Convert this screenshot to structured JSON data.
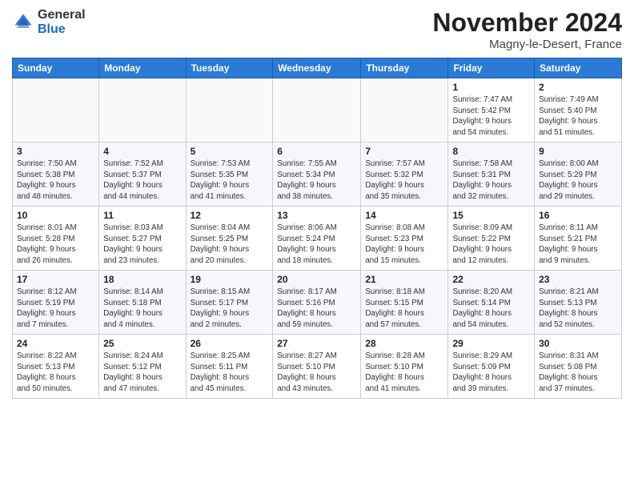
{
  "header": {
    "logo": {
      "general": "General",
      "blue": "Blue"
    },
    "title": "November 2024",
    "location": "Magny-le-Desert, France"
  },
  "weekdays": [
    "Sunday",
    "Monday",
    "Tuesday",
    "Wednesday",
    "Thursday",
    "Friday",
    "Saturday"
  ],
  "weeks": [
    [
      {
        "day": "",
        "info": ""
      },
      {
        "day": "",
        "info": ""
      },
      {
        "day": "",
        "info": ""
      },
      {
        "day": "",
        "info": ""
      },
      {
        "day": "",
        "info": ""
      },
      {
        "day": "1",
        "info": "Sunrise: 7:47 AM\nSunset: 5:42 PM\nDaylight: 9 hours\nand 54 minutes."
      },
      {
        "day": "2",
        "info": "Sunrise: 7:49 AM\nSunset: 5:40 PM\nDaylight: 9 hours\nand 51 minutes."
      }
    ],
    [
      {
        "day": "3",
        "info": "Sunrise: 7:50 AM\nSunset: 5:38 PM\nDaylight: 9 hours\nand 48 minutes."
      },
      {
        "day": "4",
        "info": "Sunrise: 7:52 AM\nSunset: 5:37 PM\nDaylight: 9 hours\nand 44 minutes."
      },
      {
        "day": "5",
        "info": "Sunrise: 7:53 AM\nSunset: 5:35 PM\nDaylight: 9 hours\nand 41 minutes."
      },
      {
        "day": "6",
        "info": "Sunrise: 7:55 AM\nSunset: 5:34 PM\nDaylight: 9 hours\nand 38 minutes."
      },
      {
        "day": "7",
        "info": "Sunrise: 7:57 AM\nSunset: 5:32 PM\nDaylight: 9 hours\nand 35 minutes."
      },
      {
        "day": "8",
        "info": "Sunrise: 7:58 AM\nSunset: 5:31 PM\nDaylight: 9 hours\nand 32 minutes."
      },
      {
        "day": "9",
        "info": "Sunrise: 8:00 AM\nSunset: 5:29 PM\nDaylight: 9 hours\nand 29 minutes."
      }
    ],
    [
      {
        "day": "10",
        "info": "Sunrise: 8:01 AM\nSunset: 5:28 PM\nDaylight: 9 hours\nand 26 minutes."
      },
      {
        "day": "11",
        "info": "Sunrise: 8:03 AM\nSunset: 5:27 PM\nDaylight: 9 hours\nand 23 minutes."
      },
      {
        "day": "12",
        "info": "Sunrise: 8:04 AM\nSunset: 5:25 PM\nDaylight: 9 hours\nand 20 minutes."
      },
      {
        "day": "13",
        "info": "Sunrise: 8:06 AM\nSunset: 5:24 PM\nDaylight: 9 hours\nand 18 minutes."
      },
      {
        "day": "14",
        "info": "Sunrise: 8:08 AM\nSunset: 5:23 PM\nDaylight: 9 hours\nand 15 minutes."
      },
      {
        "day": "15",
        "info": "Sunrise: 8:09 AM\nSunset: 5:22 PM\nDaylight: 9 hours\nand 12 minutes."
      },
      {
        "day": "16",
        "info": "Sunrise: 8:11 AM\nSunset: 5:21 PM\nDaylight: 9 hours\nand 9 minutes."
      }
    ],
    [
      {
        "day": "17",
        "info": "Sunrise: 8:12 AM\nSunset: 5:19 PM\nDaylight: 9 hours\nand 7 minutes."
      },
      {
        "day": "18",
        "info": "Sunrise: 8:14 AM\nSunset: 5:18 PM\nDaylight: 9 hours\nand 4 minutes."
      },
      {
        "day": "19",
        "info": "Sunrise: 8:15 AM\nSunset: 5:17 PM\nDaylight: 9 hours\nand 2 minutes."
      },
      {
        "day": "20",
        "info": "Sunrise: 8:17 AM\nSunset: 5:16 PM\nDaylight: 8 hours\nand 59 minutes."
      },
      {
        "day": "21",
        "info": "Sunrise: 8:18 AM\nSunset: 5:15 PM\nDaylight: 8 hours\nand 57 minutes."
      },
      {
        "day": "22",
        "info": "Sunrise: 8:20 AM\nSunset: 5:14 PM\nDaylight: 8 hours\nand 54 minutes."
      },
      {
        "day": "23",
        "info": "Sunrise: 8:21 AM\nSunset: 5:13 PM\nDaylight: 8 hours\nand 52 minutes."
      }
    ],
    [
      {
        "day": "24",
        "info": "Sunrise: 8:22 AM\nSunset: 5:13 PM\nDaylight: 8 hours\nand 50 minutes."
      },
      {
        "day": "25",
        "info": "Sunrise: 8:24 AM\nSunset: 5:12 PM\nDaylight: 8 hours\nand 47 minutes."
      },
      {
        "day": "26",
        "info": "Sunrise: 8:25 AM\nSunset: 5:11 PM\nDaylight: 8 hours\nand 45 minutes."
      },
      {
        "day": "27",
        "info": "Sunrise: 8:27 AM\nSunset: 5:10 PM\nDaylight: 8 hours\nand 43 minutes."
      },
      {
        "day": "28",
        "info": "Sunrise: 8:28 AM\nSunset: 5:10 PM\nDaylight: 8 hours\nand 41 minutes."
      },
      {
        "day": "29",
        "info": "Sunrise: 8:29 AM\nSunset: 5:09 PM\nDaylight: 8 hours\nand 39 minutes."
      },
      {
        "day": "30",
        "info": "Sunrise: 8:31 AM\nSunset: 5:08 PM\nDaylight: 8 hours\nand 37 minutes."
      }
    ]
  ]
}
